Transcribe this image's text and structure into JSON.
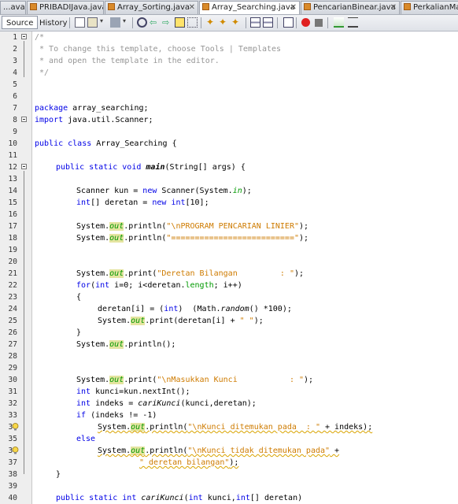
{
  "tabs": [
    {
      "label": "...ava",
      "active": false
    },
    {
      "label": "PRIBADIJava.java",
      "active": false
    },
    {
      "label": "Array_Sorting.java",
      "active": false
    },
    {
      "label": "Array_Searching.java",
      "active": true
    },
    {
      "label": "PencarianBinear.java",
      "active": false
    },
    {
      "label": "PerkalianMa",
      "active": false
    }
  ],
  "toolbar": {
    "source_label": "Source",
    "history_label": "History"
  },
  "colors": {
    "keyword": "#0000e6",
    "string": "#ce7b00",
    "comment": "#969696",
    "field": "#009900",
    "field_bg": "#e4e4a0"
  },
  "lines": [
    {
      "n": "1"
    },
    {
      "n": "2"
    },
    {
      "n": "3"
    },
    {
      "n": "4"
    },
    {
      "n": "5"
    },
    {
      "n": "6"
    },
    {
      "n": "7"
    },
    {
      "n": "8"
    },
    {
      "n": "9"
    },
    {
      "n": "10"
    },
    {
      "n": "11"
    },
    {
      "n": "12"
    },
    {
      "n": "13"
    },
    {
      "n": "14"
    },
    {
      "n": "15"
    },
    {
      "n": "16"
    },
    {
      "n": "17"
    },
    {
      "n": "18"
    },
    {
      "n": "19"
    },
    {
      "n": "20"
    },
    {
      "n": "21"
    },
    {
      "n": "22"
    },
    {
      "n": "23"
    },
    {
      "n": "24"
    },
    {
      "n": "25"
    },
    {
      "n": "26"
    },
    {
      "n": "27"
    },
    {
      "n": "28"
    },
    {
      "n": "29"
    },
    {
      "n": "30"
    },
    {
      "n": "31"
    },
    {
      "n": "32"
    },
    {
      "n": "33"
    },
    {
      "n": "34"
    },
    {
      "n": "35"
    },
    {
      "n": "36"
    },
    {
      "n": "37"
    },
    {
      "n": "38"
    },
    {
      "n": "39"
    },
    {
      "n": "40"
    }
  ],
  "code": {
    "l1": "/*",
    "l2": " * To change this template, choose Tools | Templates",
    "l3": " * and open the template in the editor.",
    "l4": " */",
    "l7a": "package",
    "l7b": " array_searching;",
    "l8a": "import",
    "l8b": " java.util.Scanner;",
    "l10a": "public class",
    "l10b": " Array_Searching {",
    "l12a": "public static void",
    "l12b": "main",
    "l12c": "(String[] args) {",
    "l14a": "Scanner kun = ",
    "l14b": "new",
    "l14c": " Scanner(System.",
    "l14d": "in",
    "l14e": ");",
    "l15a": "int",
    "l15b": "[] deretan = ",
    "l15c": "new",
    "l15d": " ",
    "l15e": "int",
    "l15f": "[10];",
    "sys": "System.",
    "out": "out",
    "l17a": ".println(",
    "l17b": "\"\\nPROGRAM PENCARIAN LINIER\"",
    "l17c": ");",
    "l18a": ".println(",
    "l18b": "\"==========================\"",
    "l18c": ");",
    "l21a": ".print(",
    "l21b": "\"Deretan Bilangan         : \"",
    "l21c": ");",
    "l22a": "for",
    "l22b": "(",
    "l22c": "int",
    "l22d": " i=0; i<deretan.",
    "l22e": "length",
    "l22f": "; i++)",
    "l23": "{",
    "l24a": "deretan[i] = (",
    "l24b": "int",
    "l24c": ")  (Math.",
    "l24d": "random",
    "l24e": "() *100);",
    "l25a": ".print(deretan[i] + ",
    "l25b": "\" \"",
    "l25c": ");",
    "l26": "}",
    "l27a": ".println();",
    "l30a": ".print(",
    "l30b": "\"\\nMasukkan Kunci           : \"",
    "l30c": ");",
    "l31a": "int",
    "l31b": " kunci=kun.nextInt();",
    "l32a": "int",
    "l32b": " indeks = ",
    "l32c": "cariKunci",
    "l32d": "(kunci,deretan);",
    "l33a": "if",
    "l33b": " (indeks != -1)",
    "l34a": ".println(",
    "l34b": "\"\\nKunci ditemukan pada  : \"",
    "l34c": " + indeks);",
    "l35a": "else",
    "l36a": ".println(",
    "l36b": "\"\\nKunci tidak ditemukan pada\"",
    "l36c": " +",
    "l37a": "\" deretan bilangan\"",
    "l37b": ");",
    "l38": "}",
    "l40a": "public static int",
    "l40b": " ",
    "l40c": "cariKunci",
    "l40d": "(",
    "l40e": "int",
    "l40f": " kunci,",
    "l40g": "int",
    "l40h": "[] deretan)"
  }
}
